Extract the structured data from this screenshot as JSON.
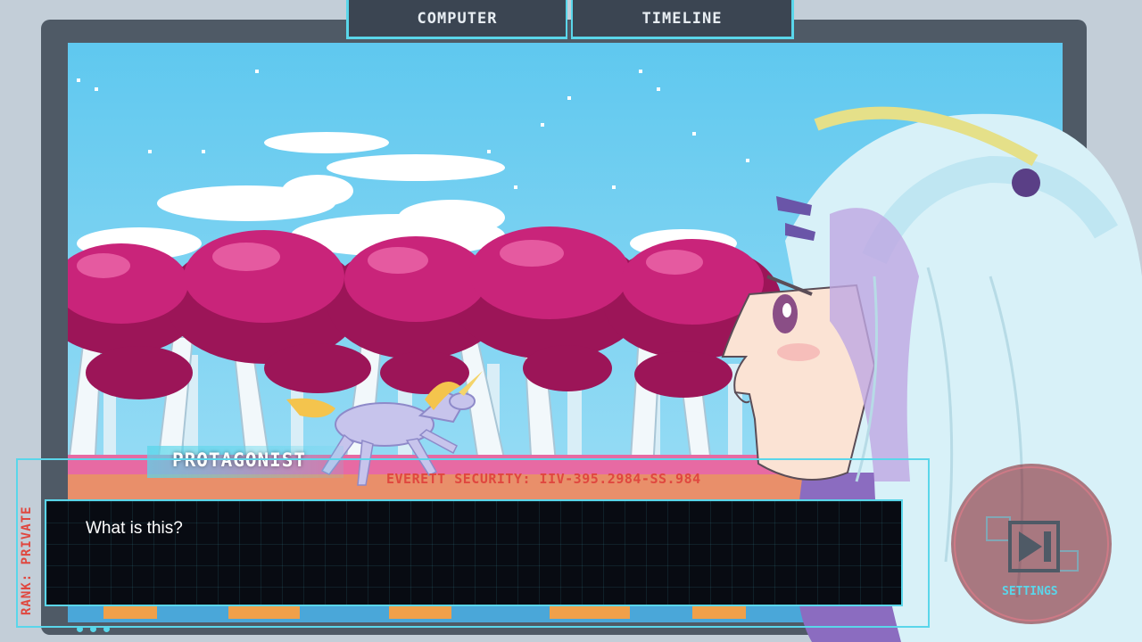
{
  "tabs": [
    {
      "label": "COMPUTER"
    },
    {
      "label": "TIMELINE"
    }
  ],
  "dialogue": {
    "speaker": "PROTAGONIST",
    "text": "What is this?"
  },
  "security_text": "EVERETT SECURITY: IIV-395.2984-SS.984",
  "rank_label": "RANK: PRIVATE",
  "settings_label": "SETTINGS",
  "colors": {
    "accent": "#5ad6ea",
    "alert": "#e0473f",
    "frame": "#4f5a66",
    "tree_foliage": "#b81e68"
  }
}
